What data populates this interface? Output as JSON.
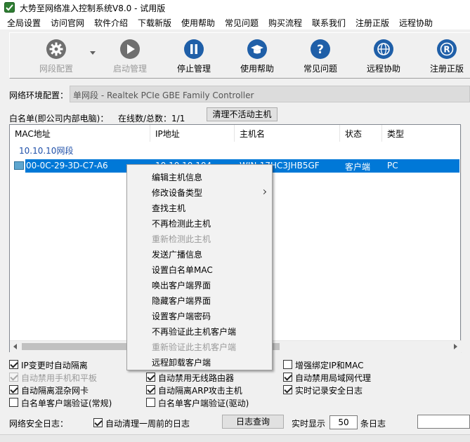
{
  "window": {
    "title": "大势至网络准入控制系统V8.0 - 试用版"
  },
  "menu": [
    "全局设置",
    "访问官网",
    "软件介绍",
    "下载新版",
    "使用帮助",
    "常见问题",
    "购买流程",
    "联系我们",
    "注册正版",
    "远程协助"
  ],
  "toolbar": {
    "items": [
      {
        "label": "网段配置",
        "icon": "gear-icon",
        "enabled": false
      },
      {
        "label": "启动管理",
        "icon": "play-icon",
        "enabled": false
      },
      {
        "label": "停止管理",
        "icon": "pause-icon",
        "enabled": true
      },
      {
        "label": "使用帮助",
        "icon": "graduation-cap-icon",
        "enabled": true
      },
      {
        "label": "常见问题",
        "icon": "question-icon",
        "enabled": true
      },
      {
        "label": "远程协助",
        "icon": "globe-icon",
        "enabled": true
      },
      {
        "label": "注册正版",
        "icon": "registered-icon",
        "enabled": true
      }
    ]
  },
  "network": {
    "label": "网络环境配置：",
    "value": "单网段 - Realtek PCIe GBE Family Controller"
  },
  "whitelist": {
    "label": "白名单(即公司内部电脑)：",
    "count_text": "在线数/总数：1/1",
    "clear_button": "清理不活动主机"
  },
  "table": {
    "columns": [
      "MAC地址",
      "IP地址",
      "主机名",
      "状态",
      "类型"
    ],
    "group": "10.10.10网段",
    "rows": [
      {
        "mac": "00-0C-29-3D-C7-A6",
        "ip": "10.10.10.104",
        "host": "WIN-17HC3JHB5GF",
        "status": "客户端",
        "type": "PC"
      }
    ]
  },
  "context_menu": [
    {
      "label": "编辑主机信息",
      "enabled": true
    },
    {
      "label": "修改设备类型",
      "enabled": true,
      "submenu": true
    },
    {
      "label": "查找主机",
      "enabled": true
    },
    {
      "label": "不再检测此主机",
      "enabled": true
    },
    {
      "label": "重新检测此主机",
      "enabled": false
    },
    {
      "label": "发送广播信息",
      "enabled": true
    },
    {
      "label": "设置白名单MAC",
      "enabled": true
    },
    {
      "label": "唤出客户端界面",
      "enabled": true
    },
    {
      "label": "隐藏客户端界面",
      "enabled": true
    },
    {
      "label": "设置客户端密码",
      "enabled": true
    },
    {
      "label": "不再验证此主机客户端",
      "enabled": true
    },
    {
      "label": "重新验证此主机客户端",
      "enabled": false
    },
    {
      "label": "远程卸载客户端",
      "enabled": true
    }
  ],
  "options": [
    {
      "label": "IP变更时自动隔离",
      "checked": true,
      "enabled": true
    },
    {
      "label": "自动禁用无线路由器",
      "checked": true,
      "enabled": true
    },
    {
      "label": "增强绑定IP和MAC",
      "checked": false,
      "enabled": true
    },
    {
      "label": "自动禁用手机和平板",
      "checked": true,
      "enabled": false
    },
    {
      "label": "自动禁用局域网代理",
      "checked": true,
      "enabled": true
    },
    {
      "label": "自动隔离混杂网卡",
      "checked": true,
      "enabled": true
    },
    {
      "label": "自动隔离ARP攻击主机",
      "checked": true,
      "enabled": true
    },
    {
      "label": "实时记录安全日志",
      "checked": true,
      "enabled": true
    },
    {
      "label": "白名单客户端验证(常规)",
      "checked": false,
      "enabled": true
    },
    {
      "label": "白名单客户端验证(驱动)",
      "checked": false,
      "enabled": true
    }
  ],
  "log": {
    "label": "网络安全日志：",
    "auto_clean": {
      "label": "自动清理一周前的日志",
      "checked": true
    },
    "query_button": "日志查询",
    "realtime_label": "实时显示",
    "realtime_value": "50",
    "realtime_unit": "条日志"
  },
  "colors": {
    "selection": "#0078d7",
    "icon_blue": "#1f5fa8",
    "icon_gray": "#6f6f6f",
    "group_text": "#1e4fa8"
  }
}
